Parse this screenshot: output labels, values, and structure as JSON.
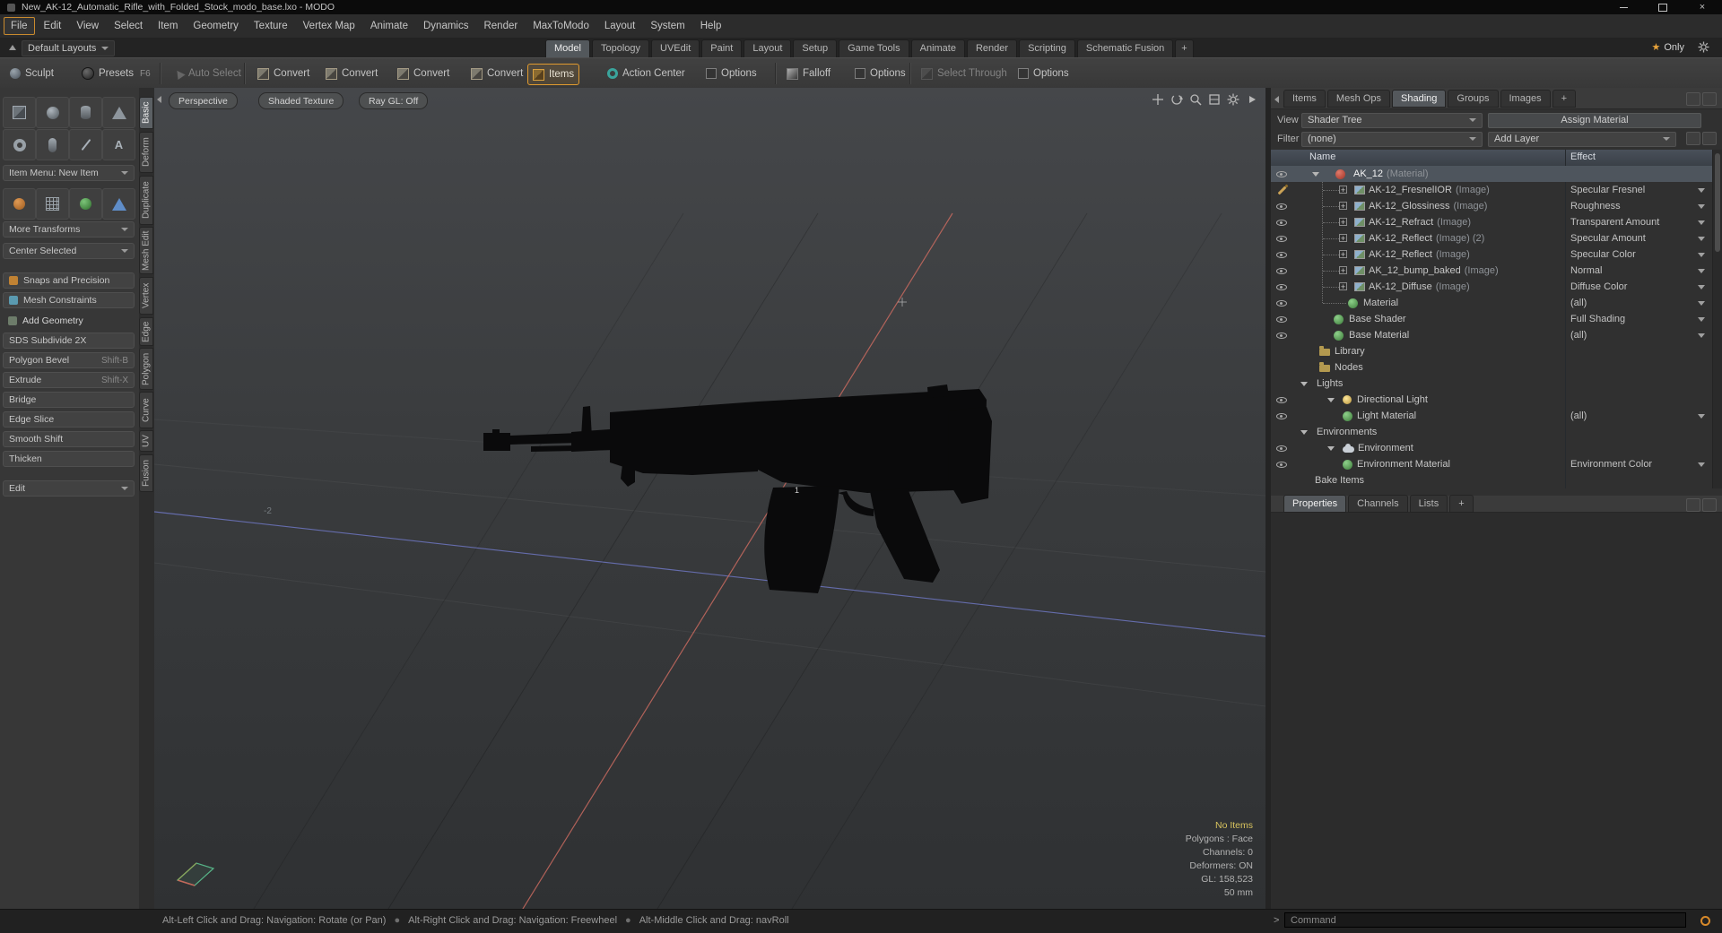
{
  "window": {
    "title": "New_AK-12_Automatic_Rifle_with_Folded_Stock_modo_base.lxo - MODO"
  },
  "menu": {
    "items": [
      "File",
      "Edit",
      "View",
      "Select",
      "Item",
      "Geometry",
      "Texture",
      "Vertex Map",
      "Animate",
      "Dynamics",
      "Render",
      "MaxToModo",
      "Layout",
      "System",
      "Help"
    ]
  },
  "layout_bar": {
    "preset": "Default Layouts",
    "tabs": [
      "Model",
      "Topology",
      "UVEdit",
      "Paint",
      "Layout",
      "Setup",
      "Game Tools",
      "Animate",
      "Render",
      "Scripting",
      "Schematic Fusion"
    ],
    "add_tab": "+",
    "only": "Only"
  },
  "toolbar": {
    "sculpt": "Sculpt",
    "presets": "Presets",
    "presets_key": "F6",
    "auto_select": "Auto Select",
    "convert": "Convert",
    "items": "Items",
    "action_center": "Action Center",
    "options": "Options",
    "falloff": "Falloff",
    "select_through": "Select Through"
  },
  "sidebar": {
    "item_menu": "Item Menu: New Item",
    "more_transforms": "More Transforms",
    "center_selected": "Center Selected",
    "snaps": "Snaps and Precision",
    "mesh_constraints": "Mesh Constraints",
    "add_geometry": "Add Geometry",
    "tools": [
      {
        "label": "SDS Subdivide 2X",
        "shortcut": ""
      },
      {
        "label": "Polygon Bevel",
        "shortcut": "Shift-B"
      },
      {
        "label": "Extrude",
        "shortcut": "Shift-X"
      },
      {
        "label": "Bridge",
        "shortcut": ""
      },
      {
        "label": "Edge Slice",
        "shortcut": ""
      },
      {
        "label": "Smooth Shift",
        "shortcut": ""
      },
      {
        "label": "Thicken",
        "shortcut": ""
      }
    ],
    "edit": "Edit"
  },
  "mode_tabs": [
    "Basic",
    "Deform",
    "Duplicate",
    "Mesh Edit",
    "Vertex",
    "Edge",
    "Polygon",
    "Curve",
    "UV",
    "Fusion"
  ],
  "viewport": {
    "perspective": "Perspective",
    "shading": "Shaded Texture",
    "raygl": "Ray GL: Off",
    "grid_label": "-2",
    "item_label": "1",
    "stats": {
      "no_items": "No Items",
      "polygons": "Polygons : Face",
      "channels": "Channels: 0",
      "deformers": "Deformers: ON",
      "gl": "GL: 158,523",
      "grid_size": "50 mm"
    }
  },
  "right_panel": {
    "tabs": [
      "Items",
      "Mesh Ops",
      "Shading",
      "Groups",
      "Images"
    ],
    "add_tab": "+",
    "view_label": "View",
    "view_value": "Shader Tree",
    "assign_material": "Assign Material",
    "filter_label": "Filter",
    "filter_value": "(none)",
    "add_layer": "Add Layer",
    "columns": {
      "name": "Name",
      "effect": "Effect"
    },
    "rows": [
      {
        "name": "AK_12",
        "suffix": "(Material)",
        "effect": ""
      },
      {
        "name": "AK-12_FresnelIOR",
        "suffix": "(Image)",
        "effect": "Specular Fresnel"
      },
      {
        "name": "AK-12_Glossiness",
        "suffix": "(Image)",
        "effect": "Roughness"
      },
      {
        "name": "AK-12_Refract",
        "suffix": "(Image)",
        "effect": "Transparent Amount"
      },
      {
        "name": "AK-12_Reflect",
        "suffix": "(Image) (2)",
        "effect": "Specular Amount"
      },
      {
        "name": "AK-12_Reflect",
        "suffix": "(Image)",
        "effect": "Specular Color"
      },
      {
        "name": "AK_12_bump_baked",
        "suffix": "(Image)",
        "effect": "Normal"
      },
      {
        "name": "AK-12_Diffuse",
        "suffix": "(Image)",
        "effect": "Diffuse Color"
      },
      {
        "name": "Material",
        "suffix": "",
        "effect": "(all)"
      },
      {
        "name": "Base Shader",
        "suffix": "",
        "effect": "Full Shading"
      },
      {
        "name": "Base Material",
        "suffix": "",
        "effect": "(all)"
      },
      {
        "name": "Library",
        "suffix": "",
        "effect": ""
      },
      {
        "name": "Nodes",
        "suffix": "",
        "effect": ""
      },
      {
        "name": "Lights",
        "suffix": "",
        "effect": ""
      },
      {
        "name": "Directional Light",
        "suffix": "",
        "effect": ""
      },
      {
        "name": "Light Material",
        "suffix": "",
        "effect": "(all)"
      },
      {
        "name": "Environments",
        "suffix": "",
        "effect": ""
      },
      {
        "name": "Environment",
        "suffix": "",
        "effect": ""
      },
      {
        "name": "Environment Material",
        "suffix": "",
        "effect": "Environment Color"
      },
      {
        "name": "Bake Items",
        "suffix": "",
        "effect": ""
      }
    ],
    "bottom_tabs": [
      "Properties",
      "Channels",
      "Lists"
    ],
    "bottom_add_tab": "+",
    "command": {
      "prompt": ">",
      "placeholder": "Command"
    }
  },
  "status": {
    "help_parts": [
      "Alt-Left Click and Drag: Navigation: Rotate (or Pan)",
      "Alt-Right Click and Drag: Navigation: Freewheel",
      "Alt-Middle Click and Drag: navRoll"
    ]
  },
  "colors": {
    "accent_orange": "#e09a2f",
    "selection": "#4e555d",
    "status_yellow": "#d8c35e",
    "axis_red": "#c86a5f",
    "axis_blue": "#7079c8"
  }
}
